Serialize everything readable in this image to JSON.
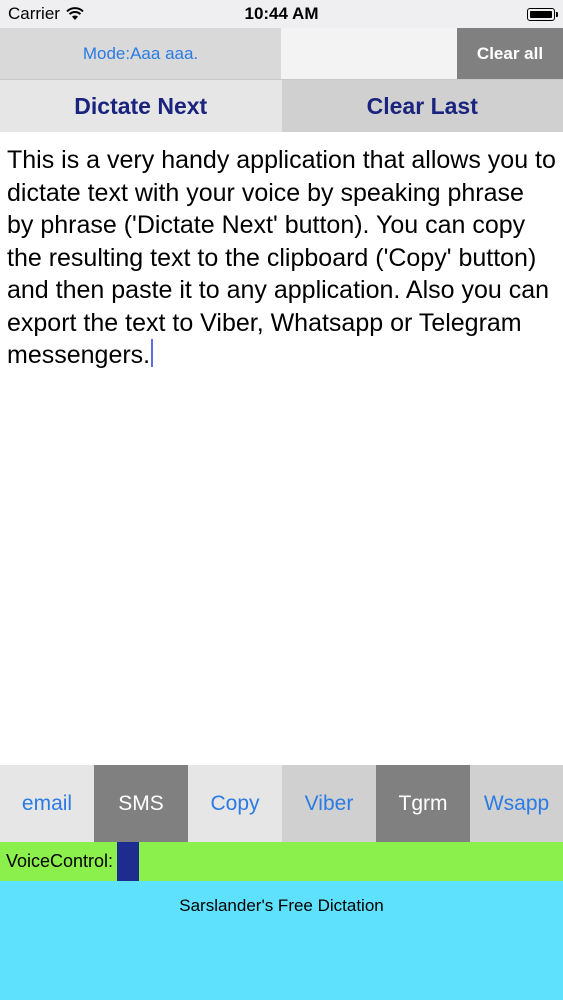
{
  "statusbar": {
    "carrier": "Carrier",
    "time": "10:44 AM"
  },
  "top": {
    "mode": "Mode:Aaa aaa.",
    "clear_all": "Clear all",
    "dictate_next": "Dictate Next",
    "clear_last": "Clear Last"
  },
  "text_area": {
    "content": "This is a very handy application that allows you to dictate text with your voice by speaking phrase by phrase ('Dictate Next' button). You can copy the resulting text to the clipboard ('Copy' button) and then paste it to any application. Also you can export the text to Viber, Whatsapp or Telegram messengers."
  },
  "toolbar": {
    "email": "email",
    "sms": "SMS",
    "copy": "Copy",
    "viber": "Viber",
    "tgrm": "Tgrm",
    "wsapp": "Wsapp"
  },
  "voice": {
    "label": "VoiceControl:"
  },
  "banner": {
    "text": "Sarslander's Free Dictation"
  },
  "colors": {
    "accent_blue": "#2a7be4",
    "dark_blue": "#1a237e",
    "voice_green": "#8bef4c",
    "banner_cyan": "#5ee1fd"
  }
}
